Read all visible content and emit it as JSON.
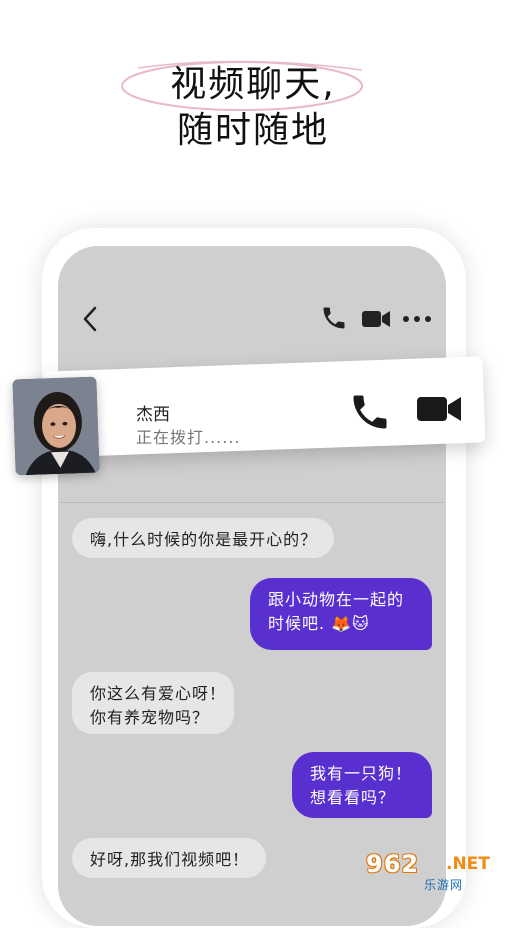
{
  "headline": {
    "line1": "视频聊天,",
    "line2": "随时随地"
  },
  "chat_header": {
    "back_icon": "chevron-left-icon",
    "call_icon": "phone-icon",
    "video_icon": "video-camera-icon",
    "more_icon": "more-horizontal-icon"
  },
  "incoming_call": {
    "caller_name": "杰西",
    "status": "正在拨打......",
    "call_icon": "phone-icon",
    "video_icon": "video-camera-icon"
  },
  "messages": [
    {
      "direction": "in",
      "lines": [
        "嗨,什么时候的你是最开心的？"
      ]
    },
    {
      "direction": "out",
      "lines": [
        "跟小动物在一起的",
        "时候吧. 🦊🐱"
      ]
    },
    {
      "direction": "in",
      "lines": [
        "你这么有爱心呀！",
        "你有养宠物吗？"
      ]
    },
    {
      "direction": "out",
      "lines": [
        "我有一只狗！",
        "想看看吗？"
      ]
    },
    {
      "direction": "in",
      "lines": [
        "好呀,那我们视频吧！"
      ]
    }
  ],
  "watermark": {
    "brand": "962",
    "suffix": ".NET",
    "site": "乐游网"
  },
  "colors": {
    "outgoing_bubble": "#5a2fd0",
    "incoming_bubble": "#e6e6e6",
    "screen_bg": "#cfcfcf",
    "headline_oval": "#e8b9c8"
  }
}
